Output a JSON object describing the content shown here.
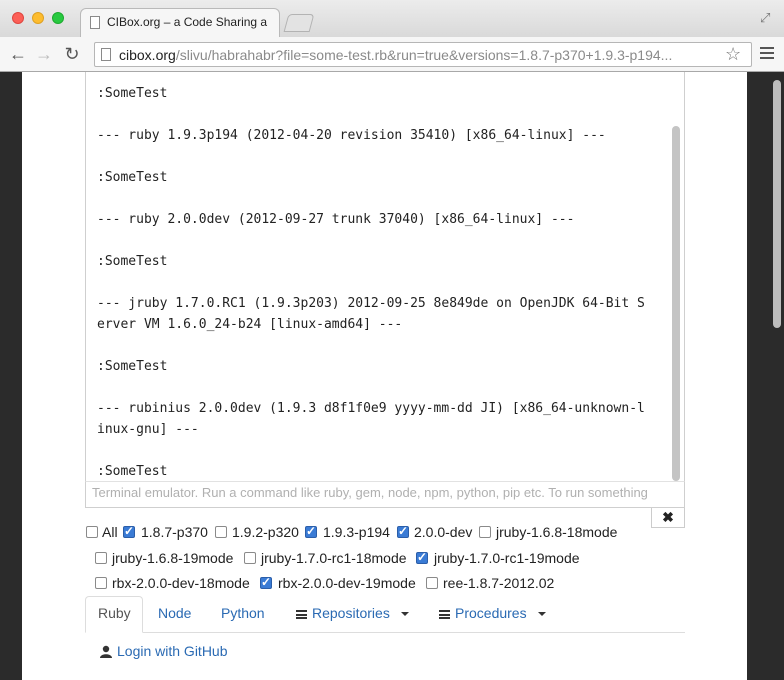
{
  "browser": {
    "tab_title": "CIBox.org – a Code Sharing a",
    "url_host": "cibox.org",
    "url_rest": "/slivu/habrahabr?file=some-test.rb&run=true&versions=1.8.7-p370+1.9.3-p194..."
  },
  "terminal": {
    "lines": [
      ":SomeTest",
      "--- ruby 1.9.3p194 (2012-04-20 revision 35410) [x86_64-linux] ---",
      ":SomeTest",
      "--- ruby 2.0.0dev (2012-09-27 trunk 37040) [x86_64-linux] ---",
      ":SomeTest",
      "--- jruby 1.7.0.RC1 (1.9.3p203) 2012-09-25 8e849de on OpenJDK 64-Bit S",
      "erver VM 1.6.0_24-b24 [linux-amd64] ---",
      ":SomeTest",
      "--- rubinius 2.0.0dev (1.9.3 d8f1f0e9 yyyy-mm-dd JI) [x86_64-unknown-l",
      "inux-gnu] ---",
      ":SomeTest"
    ],
    "placeholder": "Terminal emulator. Run a command like ruby, gem, node, npm, python, pip etc. To run something",
    "close_label": "✖"
  },
  "versions": [
    {
      "label": "All",
      "checked": false
    },
    {
      "label": "1.8.7-p370",
      "checked": true
    },
    {
      "label": "1.9.2-p320",
      "checked": false
    },
    {
      "label": "1.9.3-p194",
      "checked": true
    },
    {
      "label": "2.0.0-dev",
      "checked": true
    },
    {
      "label": "jruby-1.6.8-18mode",
      "checked": false
    },
    {
      "label": "jruby-1.6.8-19mode",
      "checked": false
    },
    {
      "label": "jruby-1.7.0-rc1-18mode",
      "checked": false
    },
    {
      "label": "jruby-1.7.0-rc1-19mode",
      "checked": true
    },
    {
      "label": "rbx-2.0.0-dev-18mode",
      "checked": false
    },
    {
      "label": "rbx-2.0.0-dev-19mode",
      "checked": true
    },
    {
      "label": "ree-1.8.7-2012.02",
      "checked": false
    }
  ],
  "nav_tabs": {
    "ruby": "Ruby",
    "node": "Node",
    "python": "Python",
    "repositories": "Repositories",
    "procedures": "Procedures"
  },
  "login": "Login with GitHub",
  "colors": {
    "accent": "#2a6ab3",
    "checkbox_checked": "#3a7bd5",
    "background_dark": "#2b2b2b"
  }
}
